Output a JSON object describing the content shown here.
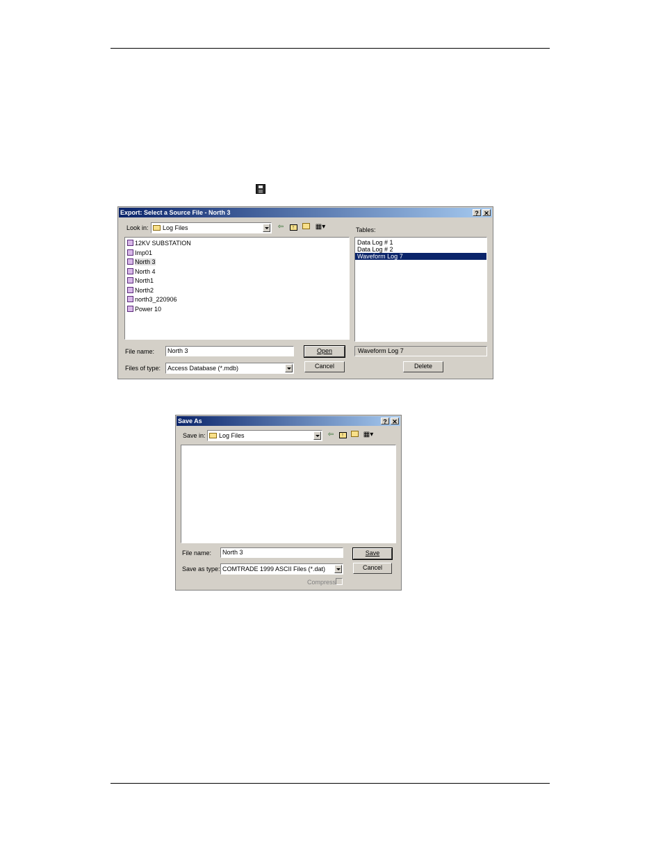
{
  "export_dialog": {
    "title": "Export: Select a Source File - North 3",
    "help_btn": "?",
    "close_btn": "✕",
    "look_in_label": "Look in:",
    "look_in_value": "Log Files",
    "files": [
      "12KV SUBSTATION",
      "Imp01",
      "North 3",
      "North 4",
      "North1",
      "North2",
      "north3_220906",
      "Power 10"
    ],
    "selected_file": "North 3",
    "tables_label": "Tables:",
    "tables": [
      "Data Log # 1",
      "Data Log # 2",
      "Waveform Log 7"
    ],
    "selected_table": "Waveform Log 7",
    "table_field": "Waveform Log 7",
    "file_name_label": "File name:",
    "file_name_value": "North 3",
    "files_of_type_label": "Files of type:",
    "files_of_type_value": "Access Database (*.mdb)",
    "open_btn": "Open",
    "cancel_btn": "Cancel",
    "delete_btn": "Delete"
  },
  "save_dialog": {
    "title": "Save As",
    "help_btn": "?",
    "close_btn": "✕",
    "save_in_label": "Save in:",
    "save_in_value": "Log Files",
    "file_name_label": "File name:",
    "file_name_value": "North 3",
    "save_type_label": "Save as type:",
    "save_type_value": "COMTRADE 1999 ASCII Files (*.dat)",
    "save_btn": "Save",
    "cancel_btn": "Cancel",
    "compress_label": "Compress"
  }
}
